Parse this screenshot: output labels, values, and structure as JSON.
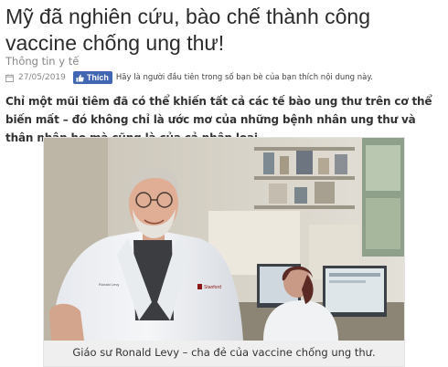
{
  "article": {
    "title": "Mỹ đã nghiên cứu, bào chế thành công vaccine chống ung thư!",
    "category": "Thông tin y tế",
    "date": "27/05/2019",
    "like_button": "Thích",
    "like_prompt": "Hãy là người đầu tiên trong số bạn bè của bạn thích nội dung này.",
    "lead": "Chỉ một mũi tiêm đã có thể khiến tất cả các tế bào ung thư trên cơ thể biến mất – đó không chỉ là ước mơ của những bệnh nhân ung thư và thân nhân họ mà cũng là của cả nhân loại.",
    "image": {
      "caption": "Giáo sư Ronald Levy – cha đẻ của vaccine chống ung thư.",
      "coat_badge": "Stanford",
      "coat_name": "Ronald Levy"
    }
  },
  "icons": {
    "date": "calendar-icon",
    "like": "thumbs-up-icon"
  },
  "colors": {
    "facebook_blue": "#4267b2",
    "title_text": "#2b2b2b",
    "meta_text": "#888888"
  }
}
